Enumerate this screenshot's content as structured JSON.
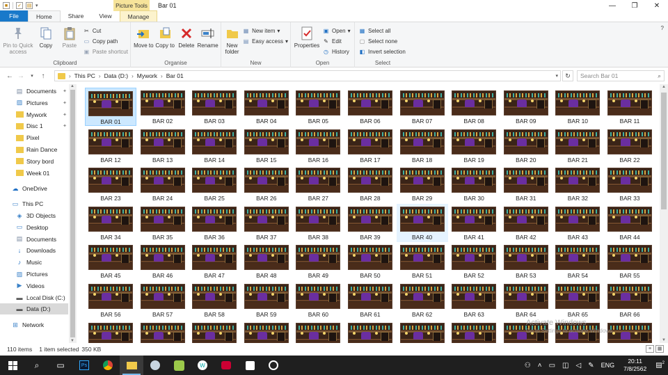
{
  "window": {
    "title": "Bar 01",
    "tool_tab": "Picture Tools",
    "controls": {
      "minimize": "—",
      "maximize": "❐",
      "close": "✕"
    }
  },
  "tabs": [
    {
      "label": "File"
    },
    {
      "label": "Home"
    },
    {
      "label": "Share"
    },
    {
      "label": "View"
    },
    {
      "label": "Manage"
    }
  ],
  "ribbon": {
    "clipboard": {
      "label": "Clipboard",
      "pin": "Pin to Quick access",
      "copy": "Copy",
      "paste": "Paste",
      "cut": "Cut",
      "copy_path": "Copy path",
      "paste_shortcut": "Paste shortcut"
    },
    "organise": {
      "label": "Organise",
      "move_to": "Move to",
      "copy_to": "Copy to",
      "delete": "Delete",
      "rename": "Rename"
    },
    "new": {
      "label": "New",
      "new_folder": "New folder",
      "new_item": "New item",
      "easy_access": "Easy access"
    },
    "open": {
      "label": "Open",
      "properties": "Properties",
      "open": "Open",
      "edit": "Edit",
      "history": "History"
    },
    "select": {
      "label": "Select",
      "select_all": "Select all",
      "select_none": "Select none",
      "invert_selection": "Invert selection"
    }
  },
  "address": {
    "crumbs": [
      "This PC",
      "Data (D:)",
      "Mywork",
      "Bar 01"
    ],
    "search_placeholder": "Search Bar 01"
  },
  "nav": {
    "quick": [
      {
        "label": "Documents",
        "pinned": true
      },
      {
        "label": "Pictures",
        "pinned": true
      },
      {
        "label": "Mywork",
        "pinned": true
      },
      {
        "label": "Disc 1",
        "pinned": true
      },
      {
        "label": "Pixel",
        "pinned": false
      },
      {
        "label": "Rain Dance",
        "pinned": false
      },
      {
        "label": "Story bord",
        "pinned": false
      },
      {
        "label": "Week 01",
        "pinned": false
      }
    ],
    "onedrive": "OneDrive",
    "thispc": "This PC",
    "pc_items": [
      "3D Objects",
      "Desktop",
      "Documents",
      "Downloads",
      "Music",
      "Pictures",
      "Videos",
      "Local Disk (C:)",
      "Data (D:)"
    ],
    "network": "Network"
  },
  "files": {
    "prefix": "BAR ",
    "visible_count": 77,
    "columns": 11,
    "selected_index": 0,
    "hover_index": 39
  },
  "watermark": {
    "line1": "Activate Windows",
    "line2": "Go to Settings to activate Windows."
  },
  "status": {
    "items": "110 items",
    "selected": "1 item selected",
    "size": "350 KB"
  },
  "taskbar": {
    "language": "ENG",
    "time": "20:11",
    "date": "7/8/2562",
    "notifications": "2"
  }
}
